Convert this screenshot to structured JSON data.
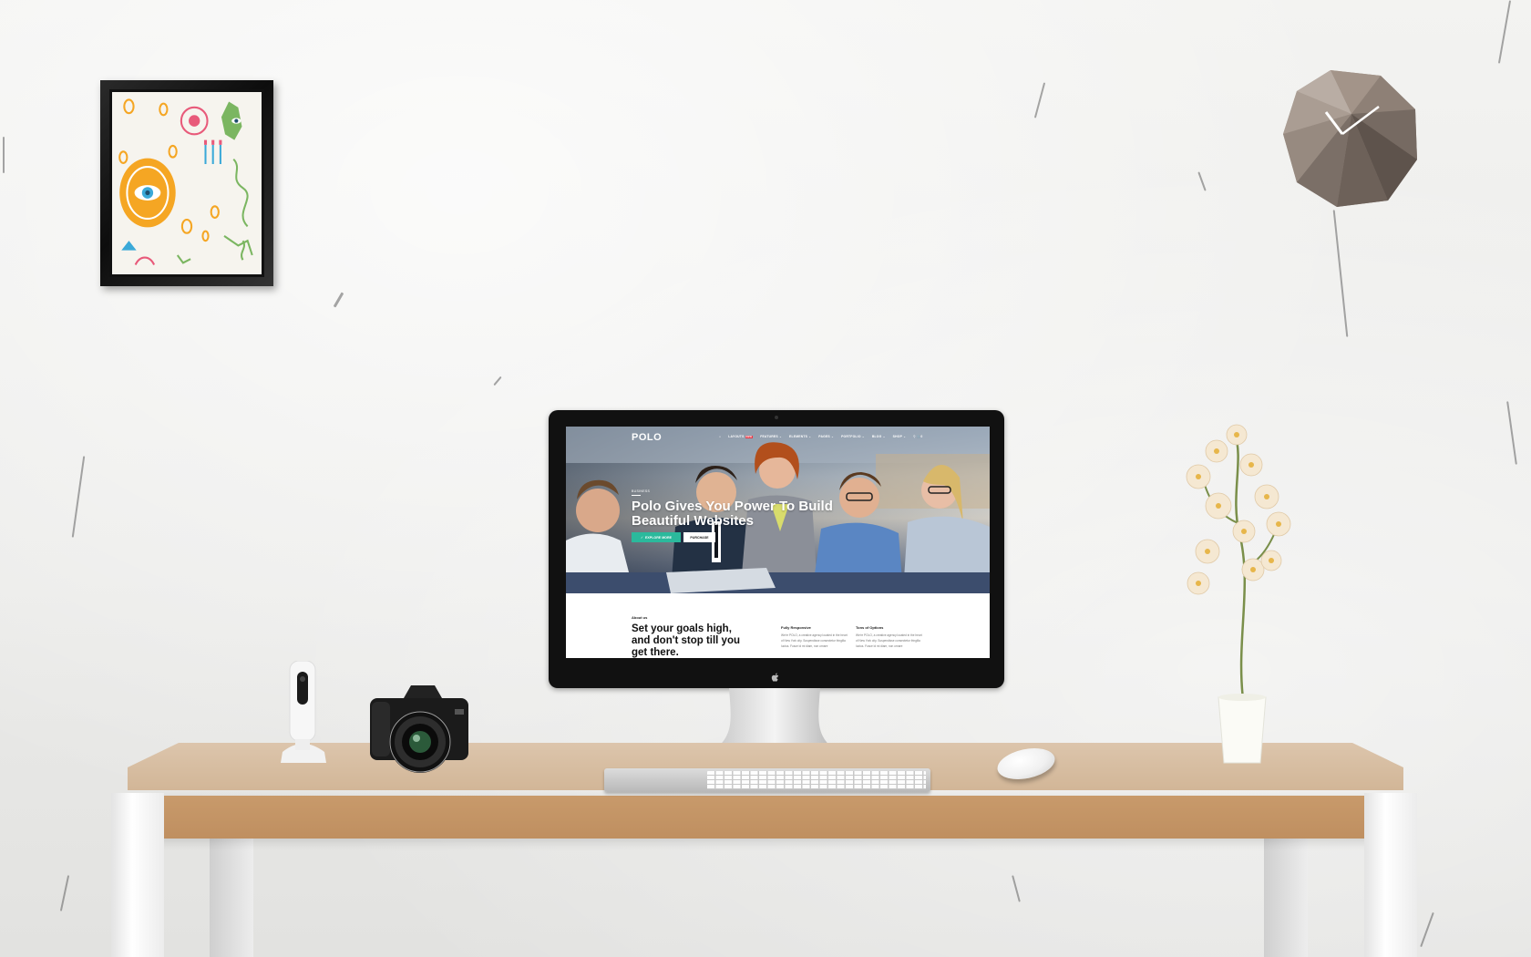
{
  "scene": {
    "description_colors": {
      "wall": "#eeeeec",
      "table_top": "#dcc5ac",
      "table_edge": "#c89a6b",
      "accent_green": "#2bb99c"
    }
  },
  "website": {
    "logo": "POLO",
    "nav": [
      {
        "label": "⌂"
      },
      {
        "label": "LAYOUTS",
        "badge": "NEW"
      },
      {
        "label": "FEATURES ⌄"
      },
      {
        "label": "ELEMENTS ⌄"
      },
      {
        "label": "PAGES ⌄"
      },
      {
        "label": "PORTFOLIO ⌄"
      },
      {
        "label": "BLOG ⌄"
      },
      {
        "label": "SHOP ⌄"
      },
      {
        "label": "⚲  🛒0"
      }
    ],
    "hero": {
      "eyebrow": "BUSINESS",
      "title": "Polo Gives You Power To Build Beautiful Websites",
      "primary_button": "EXPLORE MORE",
      "secondary_button": "PURCHASE"
    },
    "about": {
      "label": "About us",
      "title": "Set your goals high, and don't stop till you get there."
    },
    "features": [
      {
        "title": "Fully Responsive",
        "text": "We're POLO, a creative agency located in the heart of New York city. Suspendisse consectetur fringilla luctus. Fusce id mi diam, non ornare"
      },
      {
        "title": "Tons of Options",
        "text": "We're POLO, a creative agency located in the heart of New York city. Suspendisse consectetur fringilla luctus. Fusce id mi diam, non ornare"
      }
    ]
  }
}
